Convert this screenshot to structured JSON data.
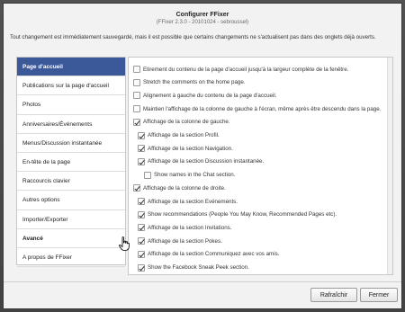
{
  "dialog": {
    "title": "Configurer FFixer",
    "subtitle": "(FFixer 2.3.0 - 20101024 - sebroussel)",
    "info": "Tout changement est immédiatement sauvegardé, mais il est possible que certains changements ne s'actualisent pas dans des onglets déjà ouverts."
  },
  "nav": {
    "items": [
      {
        "label": "Page d'accueil",
        "active": true
      },
      {
        "label": "Publications sur la page d'accueil"
      },
      {
        "label": "Photos"
      },
      {
        "label": "Anniversaires/Événements"
      },
      {
        "label": "Menus/Discussion instantanée"
      },
      {
        "label": "En-tête de la page"
      },
      {
        "label": "Raccourcis clavier"
      },
      {
        "label": "Autres options"
      },
      {
        "label": "Importer/Exporter"
      },
      {
        "label": "Avancé",
        "section": true
      },
      {
        "label": "A propos de FFixer"
      }
    ]
  },
  "options": [
    {
      "label": "Etirement du contenu de la page d'accueil jusqu'à la largeur complète de la fenêtre.",
      "checked": false,
      "indent": 0
    },
    {
      "label": "Stretch the comments on the home page.",
      "checked": false,
      "indent": 0
    },
    {
      "label": "Alignement à gauche du contenu de la page d'accueil.",
      "checked": false,
      "indent": 0
    },
    {
      "label": "Maintien l'affichage de la colonne de gauche à l'écran, même après être descendu dans la page.",
      "checked": false,
      "indent": 0
    },
    {
      "label": "Affichage de la colonne de gauche.",
      "checked": true,
      "indent": 0
    },
    {
      "label": "Affichage de la section Profil.",
      "checked": true,
      "indent": 1
    },
    {
      "label": "Affichage de la section Navigation.",
      "checked": true,
      "indent": 1
    },
    {
      "label": "Affichage de la section Discussion instantanée.",
      "checked": true,
      "indent": 1
    },
    {
      "label": "Show names in the Chat section.",
      "checked": false,
      "indent": 2
    },
    {
      "label": "Affichage de la colonne de droite.",
      "checked": true,
      "indent": 0
    },
    {
      "label": "Affichage de la section Evénements.",
      "checked": true,
      "indent": 1
    },
    {
      "label": "Show recommendations (People You May Know, Recommended Pages etc).",
      "checked": true,
      "indent": 1
    },
    {
      "label": "Affichage de la section Invitations.",
      "checked": true,
      "indent": 1
    },
    {
      "label": "Affichage de la section Pokes.",
      "checked": true,
      "indent": 1
    },
    {
      "label": "Affichage de la section Communiquez avec vos amis.",
      "checked": true,
      "indent": 1
    },
    {
      "label": "Show the Facebook Sneak Peek section.",
      "checked": true,
      "indent": 1
    }
  ],
  "buttons": {
    "refresh": "Rafraîchir",
    "close": "Fermer"
  },
  "colors": {
    "accent": "#3b5998"
  }
}
